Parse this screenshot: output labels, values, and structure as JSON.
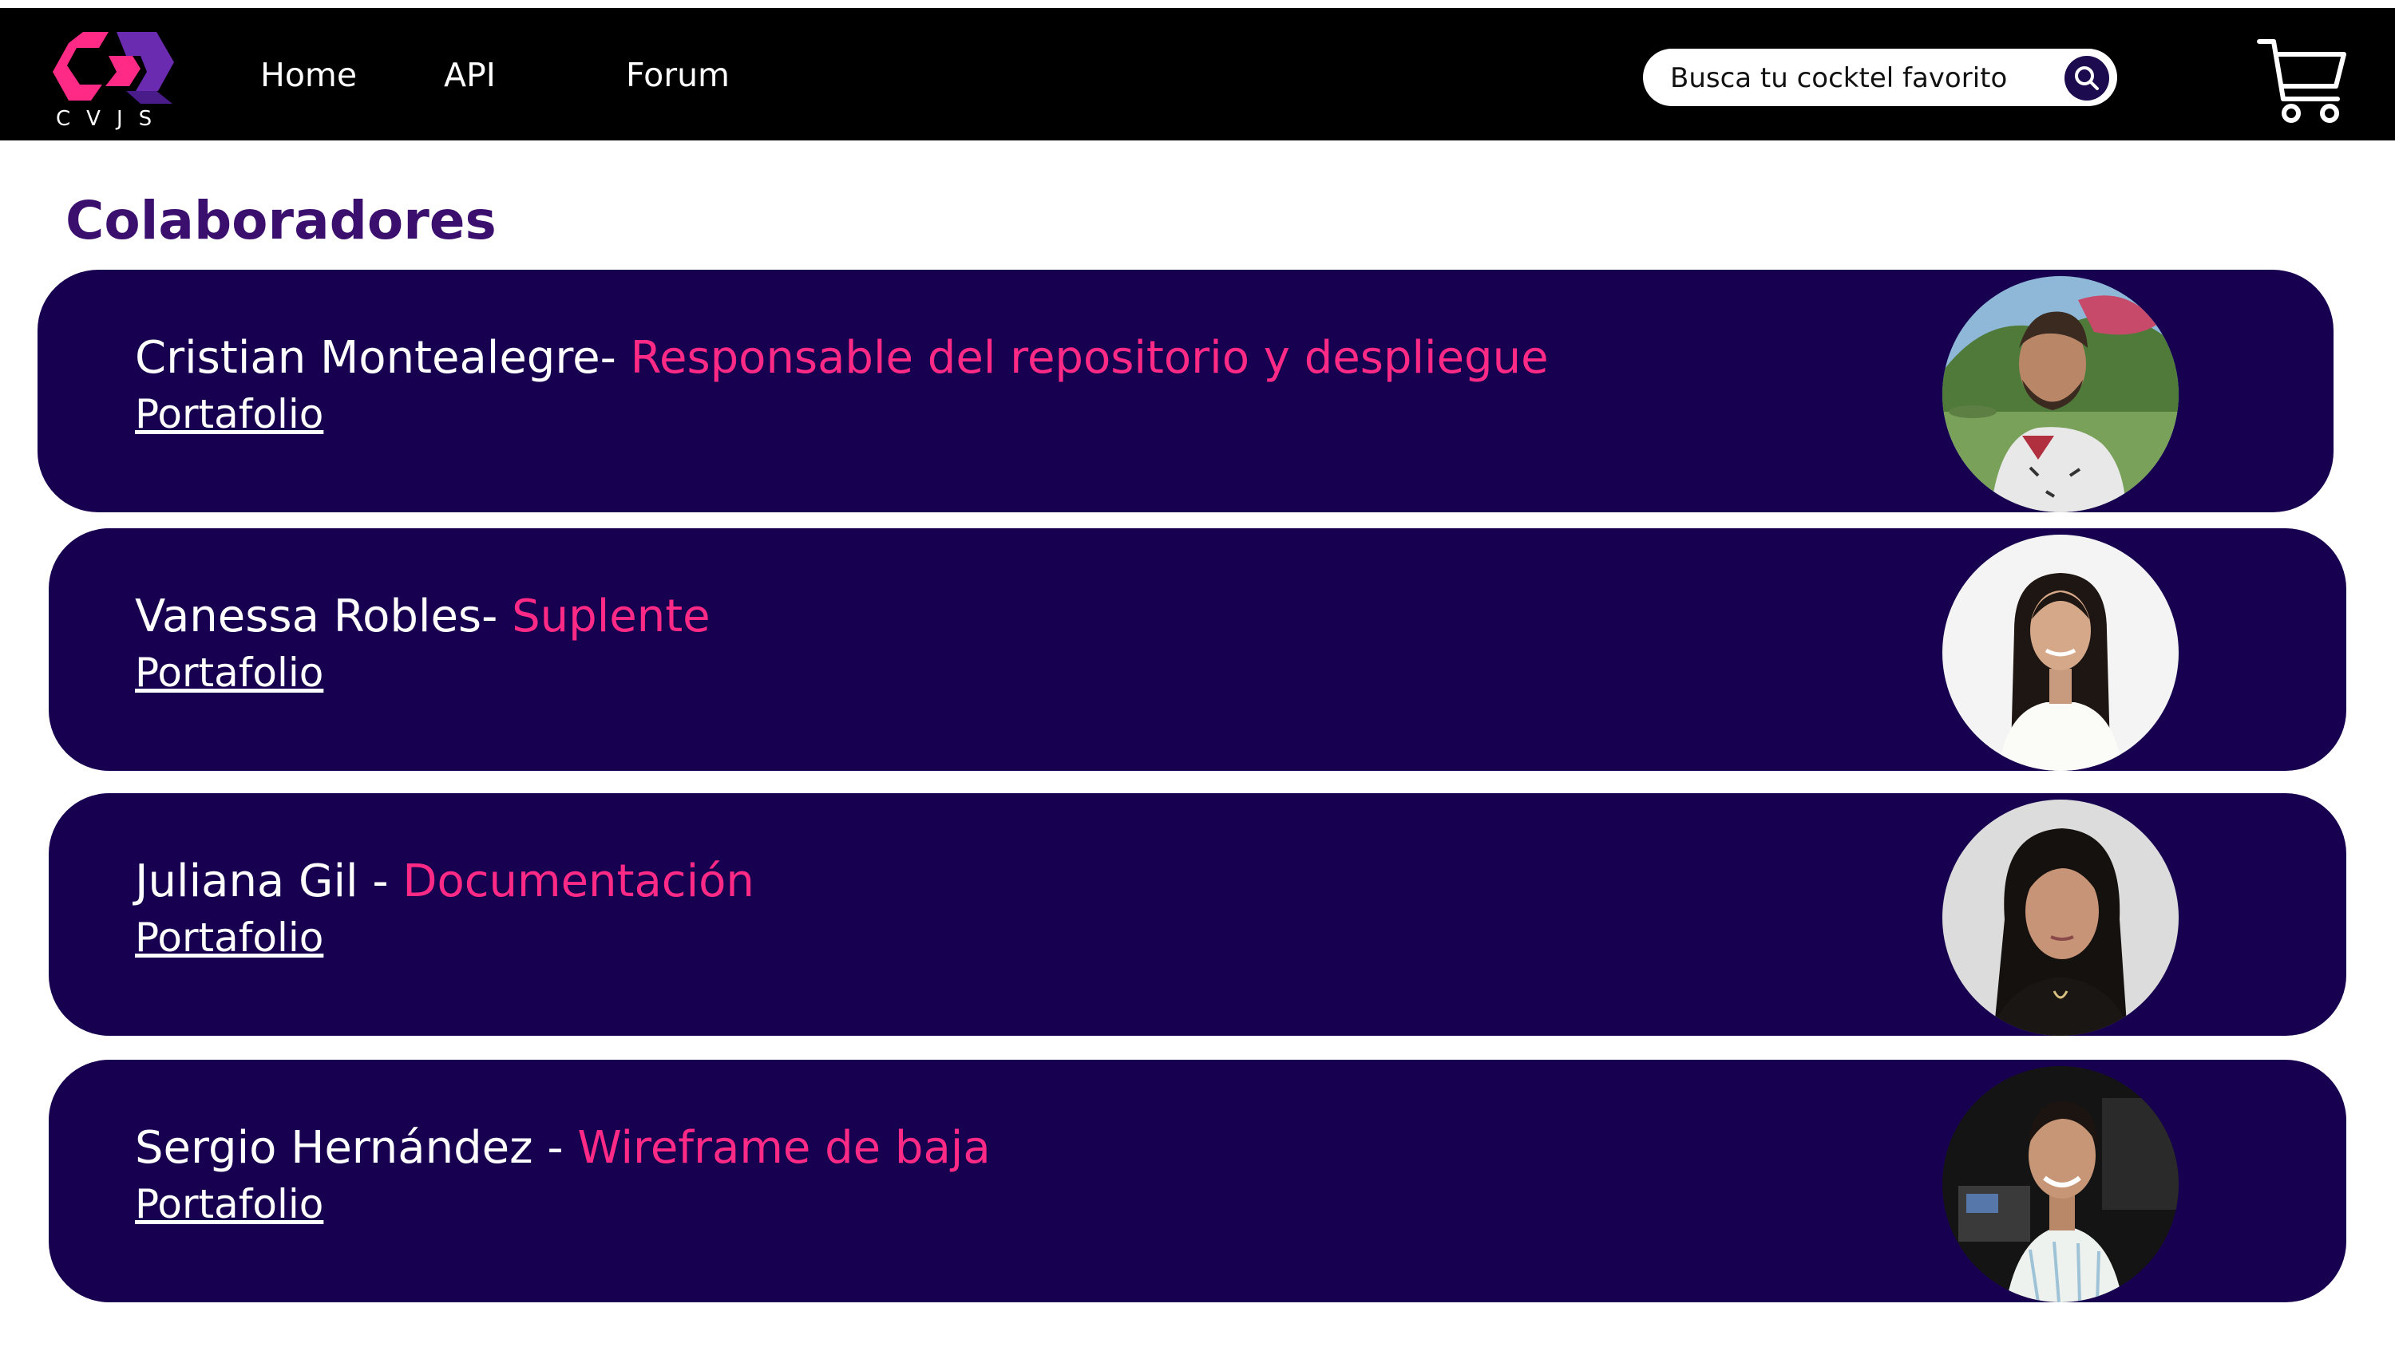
{
  "header": {
    "logo_text": "CVJS",
    "nav": [
      {
        "label": "Home"
      },
      {
        "label": "API"
      },
      {
        "label": "Forum"
      }
    ],
    "search": {
      "placeholder": "Busca tu cocktel favorito"
    },
    "cart_icon": "shopping-cart-icon",
    "search_icon": "magnifier-icon"
  },
  "main": {
    "title": "Colaboradores",
    "collaborators": [
      {
        "name": "Cristian Montealegre",
        "separator": "- ",
        "role": "Responsable del repositorio y despliegue",
        "link": "Portafolio"
      },
      {
        "name": "Vanessa Robles",
        "separator": "- ",
        "role": "Suplente",
        "link": "Portafolio"
      },
      {
        "name": "Juliana Gil",
        "separator": " - ",
        "role": "Documentación",
        "link": "Portafolio"
      },
      {
        "name": "Sergio Hernández",
        "separator": " - ",
        "role": "Wireframe de baja",
        "link": "Portafolio"
      }
    ]
  },
  "colors": {
    "navbar": "#000000",
    "card": "#180050",
    "role_accent": "#ff2a86",
    "title": "#3b0f6e",
    "logo_pink": "#ff2a86",
    "logo_purple": "#5a2a9c"
  }
}
